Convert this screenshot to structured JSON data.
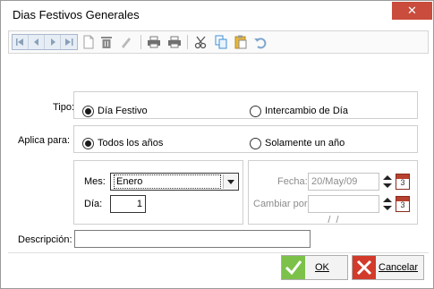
{
  "window": {
    "title": "Dias Festivos Generales",
    "close_glyph": "✕"
  },
  "toolbar": {
    "icons": [
      "first-icon",
      "prev-icon",
      "next-icon",
      "last-icon",
      "new-doc-icon",
      "delete-icon",
      "edit-icon",
      "print-icon",
      "print-preview-icon",
      "cut-icon",
      "copy-icon",
      "paste-icon",
      "undo-icon"
    ]
  },
  "tipo": {
    "label": "Tipo:",
    "option1": "Día Festivo",
    "option2": "Intercambio de Día",
    "selected": "Día Festivo"
  },
  "aplica": {
    "label": "Aplica para:",
    "option1": "Todos los años",
    "option2": "Solamente un año",
    "selected": "Todos los años"
  },
  "mes": {
    "label": "Mes:",
    "value": "Enero"
  },
  "dia": {
    "label": "Día:",
    "value": "1"
  },
  "fecha": {
    "label": "Fecha:",
    "value": "20/May/09",
    "cal_day": "3"
  },
  "cambiar": {
    "label": "Cambiar por:",
    "value": "  /  /",
    "cal_day": "3"
  },
  "descripcion": {
    "label": "Descripción:",
    "value": ""
  },
  "buttons": {
    "ok": "OK",
    "cancel": "Cancelar"
  },
  "colors": {
    "ok_green": "#7cc24a",
    "cancel_red": "#d23b2b",
    "close_red": "#c94c3c"
  }
}
